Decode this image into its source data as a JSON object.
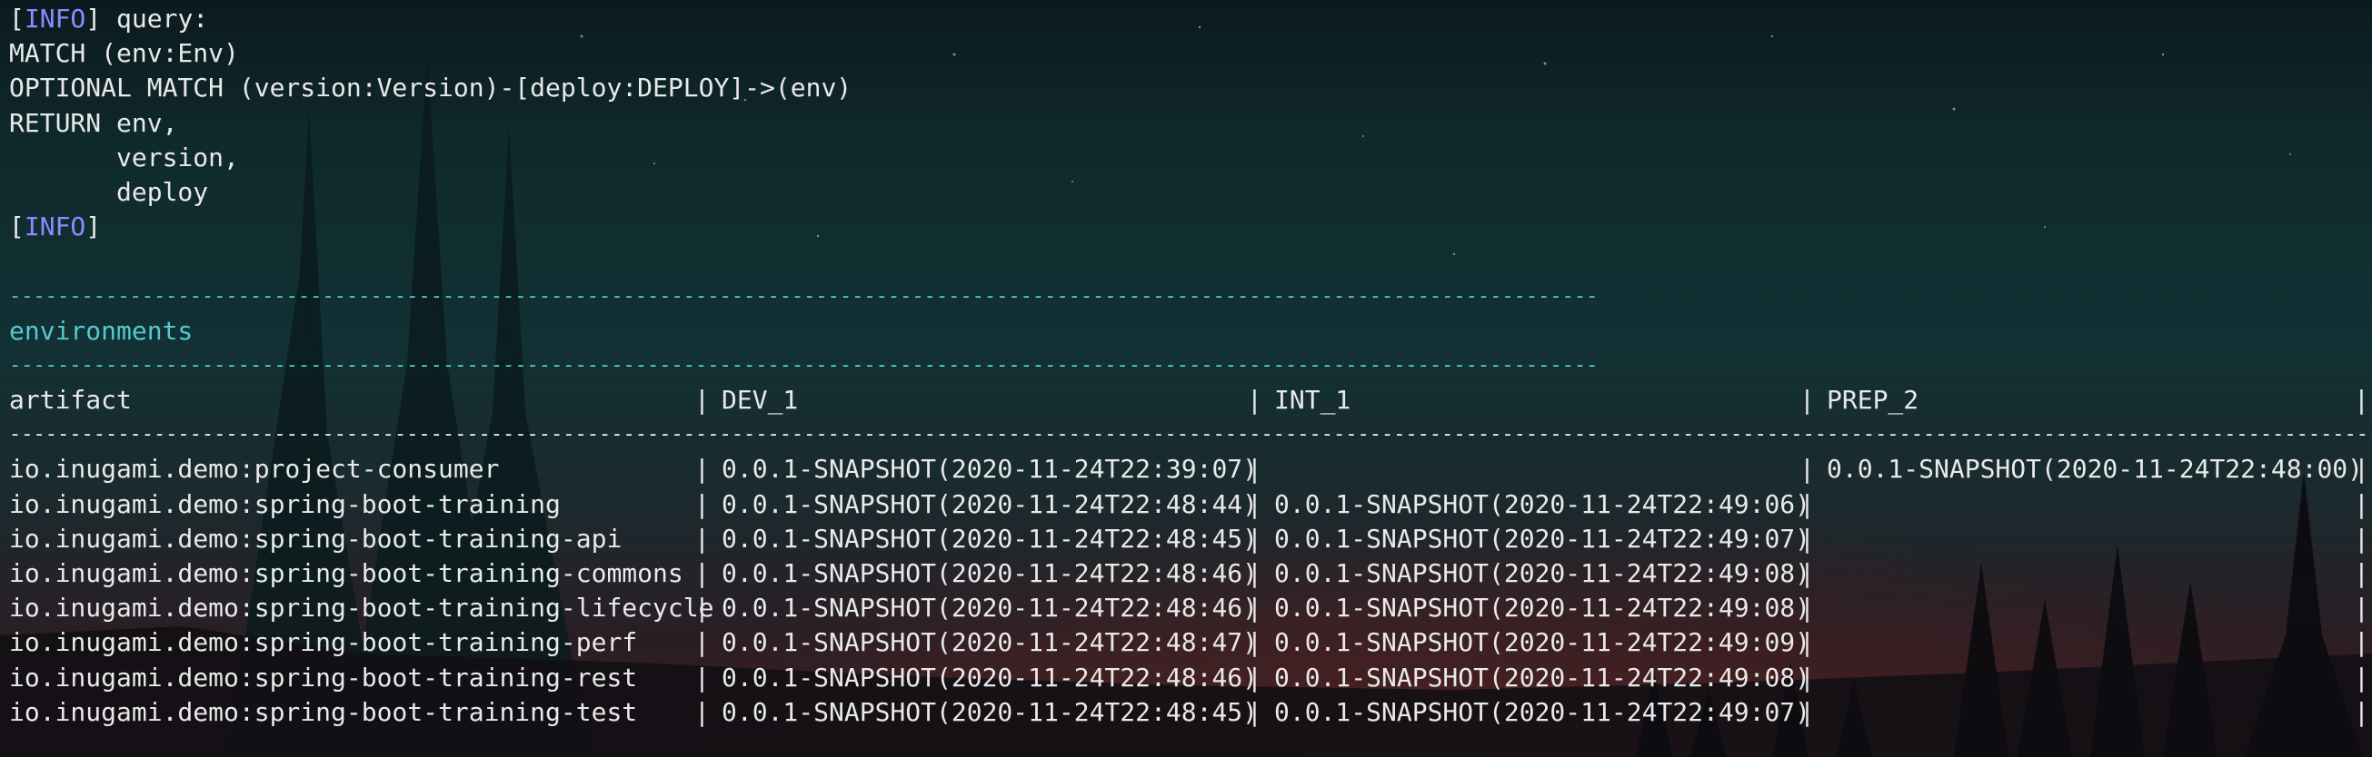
{
  "log": {
    "info_tag": "INFO",
    "bracket_open": "[",
    "bracket_close": "]",
    "query_label": " query:",
    "query_lines": [
      "MATCH (env:Env)",
      "OPTIONAL MATCH (version:Version)-[deploy:DEPLOY]->(env)",
      "RETURN env,",
      "       version,",
      "       deploy"
    ]
  },
  "section": {
    "rule": "------------------------------------------------------------------------------------------------------------------------------------",
    "title": "environments"
  },
  "table": {
    "separator": "|",
    "header_rule": "------------------------------------------------------------------------------------------------------------------------------------------------------------------------------------------------------------------------------------------------------------------------------------------------------------------------------------------",
    "headers": [
      "artifact",
      "DEV_1",
      "INT_1",
      "PREP_2"
    ],
    "rows": [
      [
        "io.inugami.demo:project-consumer",
        "0.0.1-SNAPSHOT(2020-11-24T22:39:07)",
        "",
        "0.0.1-SNAPSHOT(2020-11-24T22:48:00)"
      ],
      [
        "io.inugami.demo:spring-boot-training",
        "0.0.1-SNAPSHOT(2020-11-24T22:48:44)",
        "0.0.1-SNAPSHOT(2020-11-24T22:49:06)",
        ""
      ],
      [
        "io.inugami.demo:spring-boot-training-api",
        "0.0.1-SNAPSHOT(2020-11-24T22:48:45)",
        "0.0.1-SNAPSHOT(2020-11-24T22:49:07)",
        ""
      ],
      [
        "io.inugami.demo:spring-boot-training-commons",
        "0.0.1-SNAPSHOT(2020-11-24T22:48:46)",
        "0.0.1-SNAPSHOT(2020-11-24T22:49:08)",
        ""
      ],
      [
        "io.inugami.demo:spring-boot-training-lifecycle",
        "0.0.1-SNAPSHOT(2020-11-24T22:48:46)",
        "0.0.1-SNAPSHOT(2020-11-24T22:49:08)",
        ""
      ],
      [
        "io.inugami.demo:spring-boot-training-perf",
        "0.0.1-SNAPSHOT(2020-11-24T22:48:47)",
        "0.0.1-SNAPSHOT(2020-11-24T22:49:09)",
        ""
      ],
      [
        "io.inugami.demo:spring-boot-training-rest",
        "0.0.1-SNAPSHOT(2020-11-24T22:48:46)",
        "0.0.1-SNAPSHOT(2020-11-24T22:49:08)",
        ""
      ],
      [
        "io.inugami.demo:spring-boot-training-test",
        "0.0.1-SNAPSHOT(2020-11-24T22:48:45)",
        "0.0.1-SNAPSHOT(2020-11-24T22:49:07)",
        ""
      ]
    ]
  },
  "colors": {
    "text": "#e9e9e9",
    "info": "#8a8cff",
    "section": "#54c9cf"
  }
}
